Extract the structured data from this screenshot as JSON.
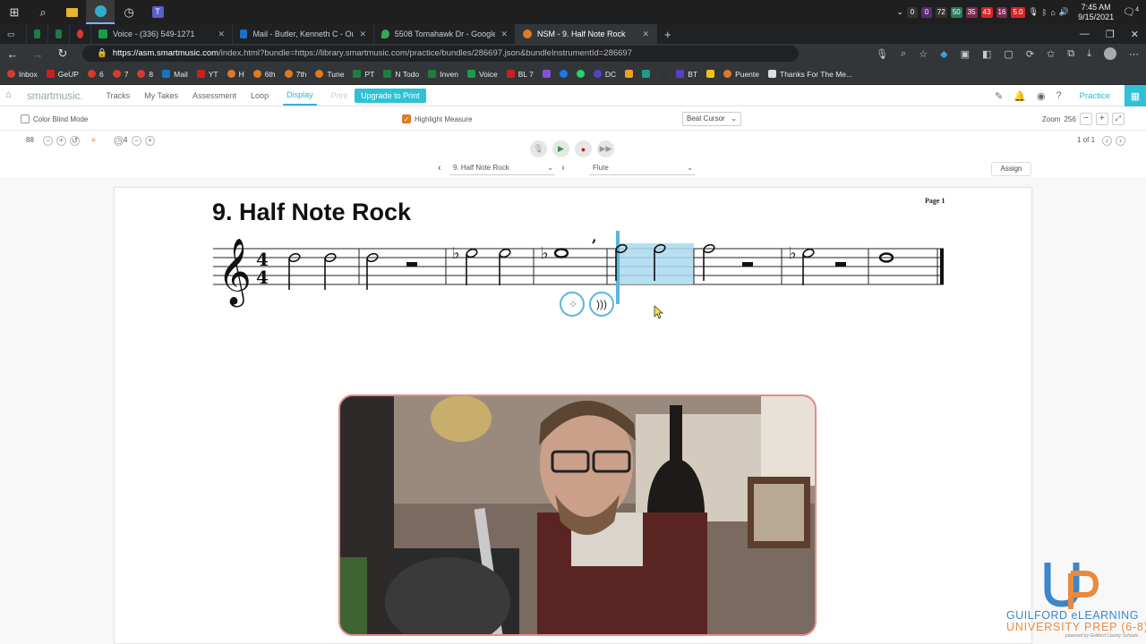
{
  "taskbar": {
    "tray_numbers": [
      "0",
      "0",
      "72",
      "50",
      "35",
      "43",
      "16",
      "5.0"
    ],
    "tray_colors": [
      "#333",
      "#5a2b6f",
      "#333",
      "#2a7a5a",
      "#7a2b4f",
      "#d82525",
      "#7a2b4f",
      "#d82525"
    ],
    "time": "7:45 AM",
    "date": "9/15/2021",
    "notification_count": "4"
  },
  "browser": {
    "tabs": [
      {
        "title": "Voice - (336) 549-1271",
        "color": "#1a9e48"
      },
      {
        "title": "Mail - Butler, Kenneth C - Outlook",
        "color": "#1873c8"
      },
      {
        "title": "5508 Tomahawk Dr - Google Ma",
        "color": "#34a853"
      },
      {
        "title": "NSM - 9. Half Note Rock",
        "color": "#e07a22"
      }
    ],
    "url_host": "https://asm.smartmusic.com",
    "url_rest": "/index.html?bundle=https://library.smartmusic.com/practice/bundles/286697.json&bundleInstrumentId=286697",
    "bookmarks": [
      {
        "label": "Inbox",
        "color": "#d83a2e"
      },
      {
        "label": "GeUP",
        "color": "#cc1f1f"
      },
      {
        "label": "6",
        "color": "#d83a2e"
      },
      {
        "label": "7",
        "color": "#d83a2e"
      },
      {
        "label": "8",
        "color": "#d83a2e"
      },
      {
        "label": "Mail",
        "color": "#1873c8"
      },
      {
        "label": "YT",
        "color": "#cc1f1f"
      },
      {
        "label": "H",
        "color": "#e07a22"
      },
      {
        "label": "6th",
        "color": "#e07a22"
      },
      {
        "label": "7th",
        "color": "#e07a22"
      },
      {
        "label": "Tune",
        "color": "#e07a22"
      },
      {
        "label": "PT",
        "color": "#1d7d3f"
      },
      {
        "label": "N Todo",
        "color": "#1d7d3f"
      },
      {
        "label": "Inven",
        "color": "#1d7d3f"
      },
      {
        "label": "Voice",
        "color": "#1a9e48"
      },
      {
        "label": "BL 7",
        "color": "#cc1f1f"
      },
      {
        "label": "DC",
        "color": "#5b3ec8"
      },
      {
        "label": "BT",
        "color": "#5b3ec8"
      },
      {
        "label": "Puente",
        "color": "#e07a22"
      },
      {
        "label": "Thanks For The Me...",
        "color": "#dddddd"
      }
    ]
  },
  "smartmusic": {
    "logo": "smartmusic.",
    "nav": [
      "Tracks",
      "My Takes",
      "Assessment",
      "Loop",
      "Display",
      "Print"
    ],
    "active_nav": "Display",
    "upgrade": "Upgrade to Print",
    "practice": "Practice",
    "options": {
      "color_blind": "Color Blind Mode",
      "highlight": "Highlight Measure",
      "cursor": "Beat Cursor",
      "zoom_label": "Zoom",
      "zoom_value": "256"
    },
    "tempo": "88",
    "count_in": "4",
    "page_indicator": "1 of 1",
    "title_select": "9. Half Note Rock",
    "instrument_select": "Flute",
    "assign": "Assign"
  },
  "score": {
    "title": "9. Half Note Rock",
    "page_label": "Page 1",
    "time_signature": [
      "4",
      "4"
    ],
    "measure_count": 8,
    "highlighted_measure": 5
  },
  "logo": {
    "line1": "GUILFORD eLEARNING",
    "line2": "UNIVERSITY PREP (6-8)",
    "line3": "powered by Guilford County Schools",
    "color_blue": "#3b87c8",
    "color_orange": "#e98a3d"
  }
}
